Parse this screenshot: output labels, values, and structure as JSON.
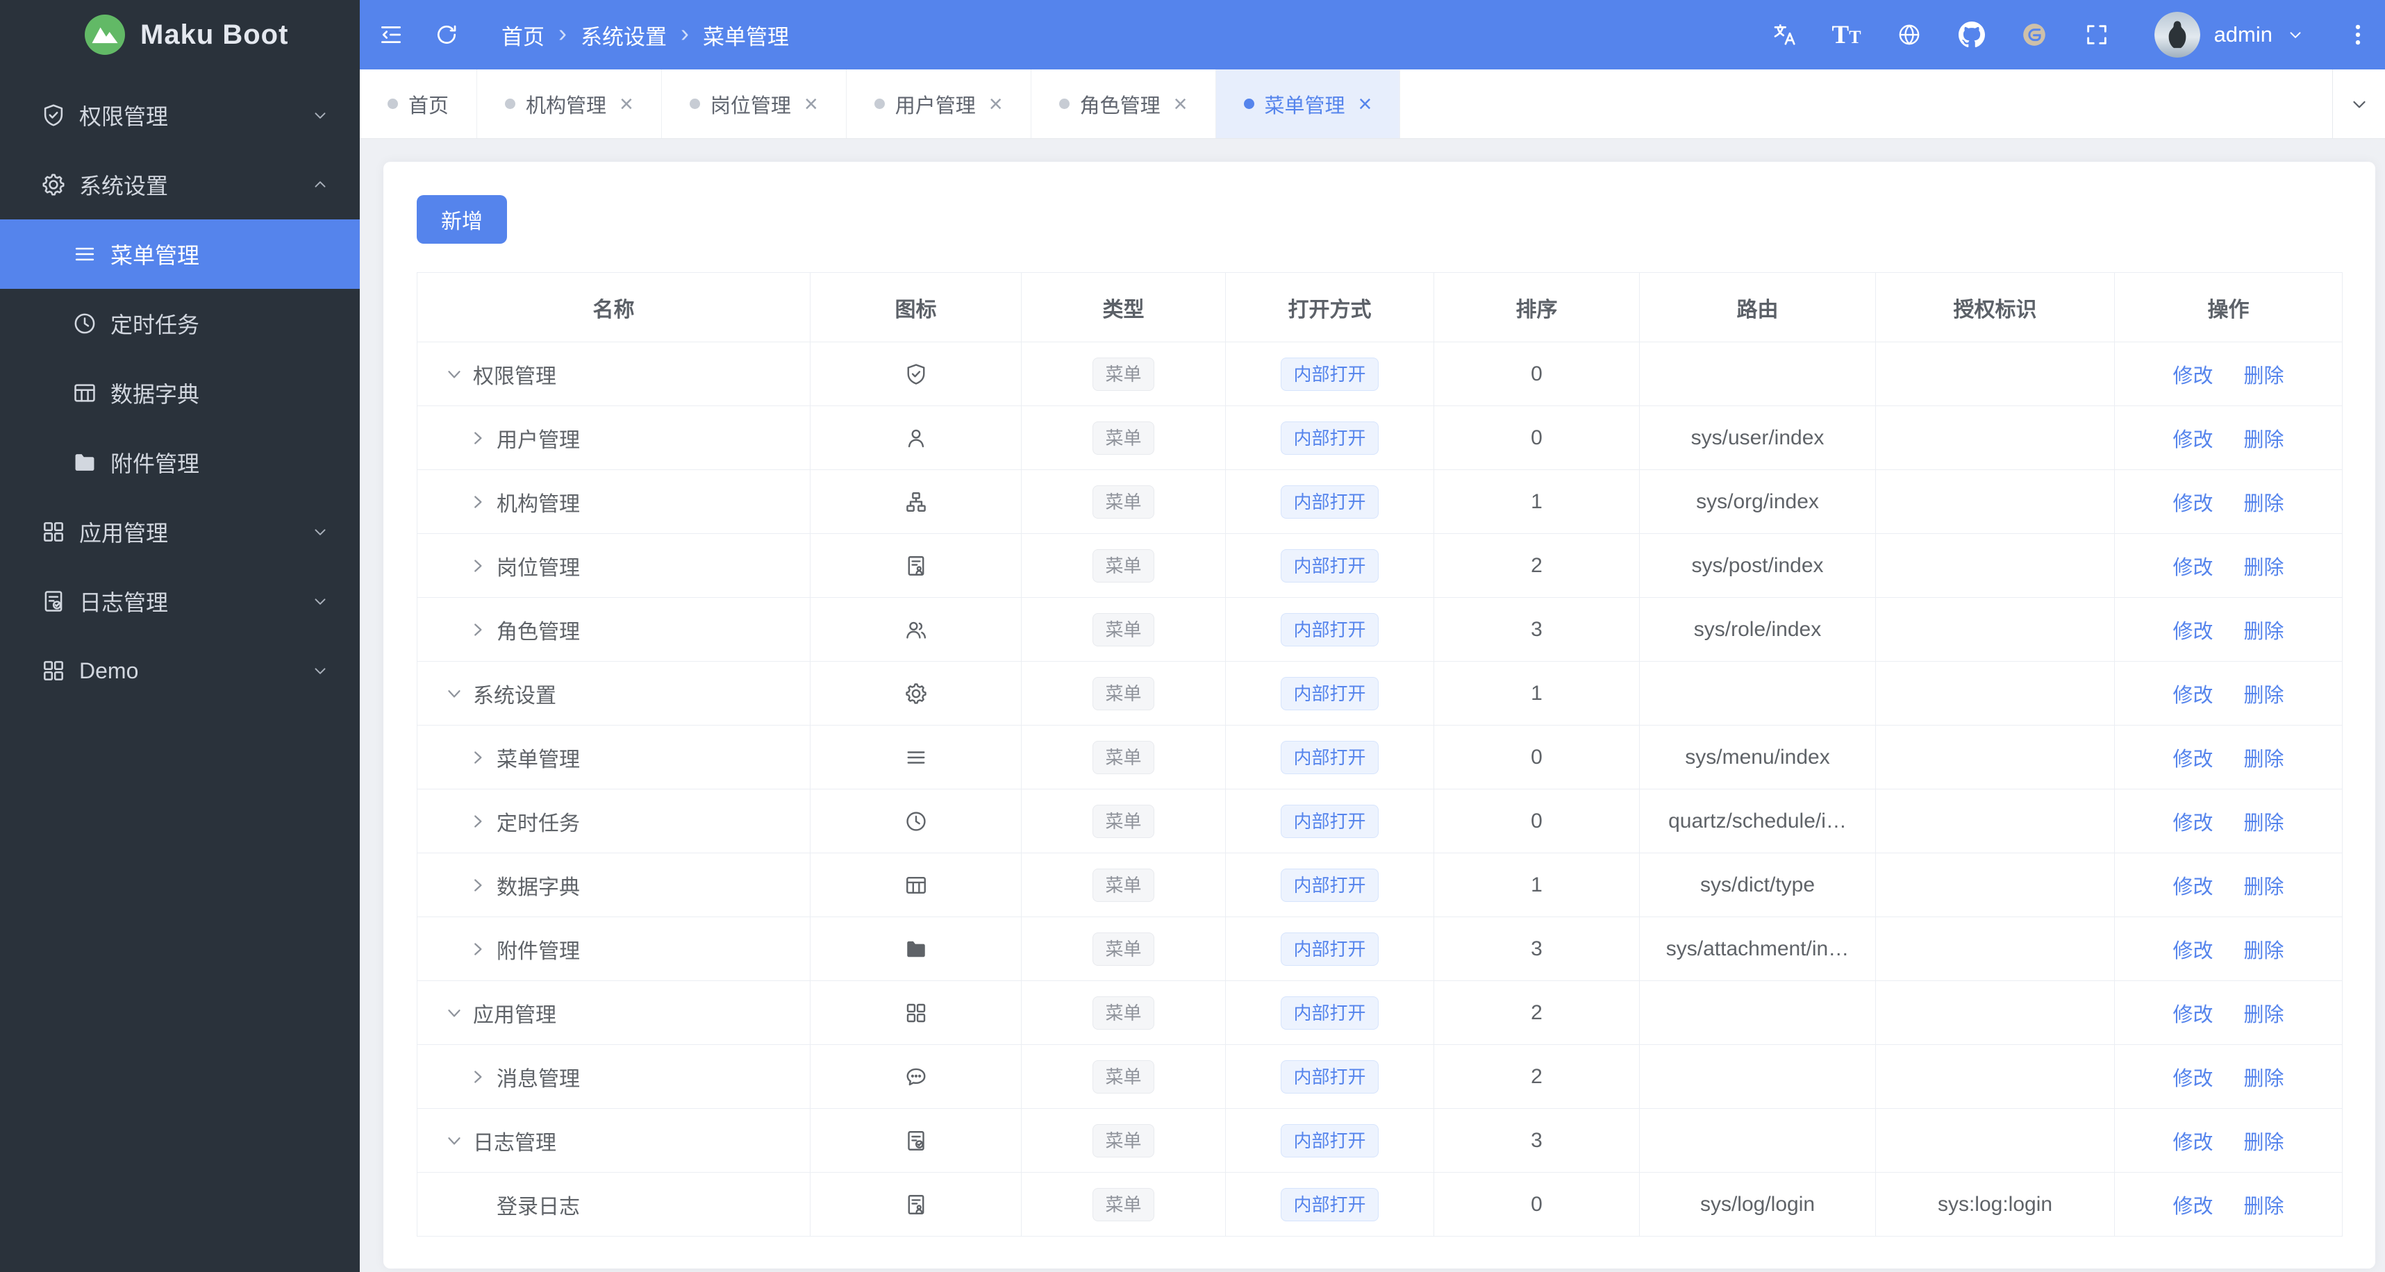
{
  "app": {
    "logo_text": "Maku Boot"
  },
  "colors": {
    "primary": "#5584ec",
    "sidebar_bg": "#2a323b",
    "header_bg": "#5584ec",
    "content_bg": "#eef0f4",
    "tab_active_bg": "#e7eefc",
    "link": "#5584ec",
    "tag_gray_text": "#8f939b",
    "tag_blue_text": "#5584ec",
    "logo_green": "#62b966",
    "gitee_tan": "#cec0a9"
  },
  "sidebar": {
    "items": [
      {
        "label": "权限管理",
        "icon": "shield-check",
        "kind": "group",
        "chevron": "down",
        "active": false
      },
      {
        "label": "系统设置",
        "icon": "gear",
        "kind": "group",
        "chevron": "up",
        "active": false
      },
      {
        "label": "菜单管理",
        "icon": "menu-lines",
        "kind": "sub",
        "chevron": "none",
        "active": true
      },
      {
        "label": "定时任务",
        "icon": "clock",
        "kind": "sub",
        "chevron": "none",
        "active": false
      },
      {
        "label": "数据字典",
        "icon": "grid-table",
        "kind": "sub",
        "chevron": "none",
        "active": false
      },
      {
        "label": "附件管理",
        "icon": "folder",
        "kind": "sub",
        "chevron": "none",
        "active": false
      },
      {
        "label": "应用管理",
        "icon": "app-grid",
        "kind": "group",
        "chevron": "down",
        "active": false
      },
      {
        "label": "日志管理",
        "icon": "doc-check",
        "kind": "group",
        "chevron": "down",
        "active": false
      },
      {
        "label": "Demo",
        "icon": "app-grid",
        "kind": "group",
        "chevron": "down",
        "active": false
      }
    ]
  },
  "header": {
    "breadcrumb": [
      "首页",
      "系统设置",
      "菜单管理"
    ],
    "tools": [
      "translate",
      "font-size",
      "globe",
      "github",
      "gitee",
      "fullscreen"
    ],
    "user": "admin"
  },
  "tabs": {
    "items": [
      {
        "label": "首页",
        "closable": false,
        "active": false
      },
      {
        "label": "机构管理",
        "closable": true,
        "active": false
      },
      {
        "label": "岗位管理",
        "closable": true,
        "active": false
      },
      {
        "label": "用户管理",
        "closable": true,
        "active": false
      },
      {
        "label": "角色管理",
        "closable": true,
        "active": false
      },
      {
        "label": "菜单管理",
        "closable": true,
        "active": true
      }
    ]
  },
  "toolbar": {
    "add_label": "新增"
  },
  "table": {
    "headers": [
      "名称",
      "图标",
      "类型",
      "打开方式",
      "排序",
      "路由",
      "授权标识",
      "操作"
    ],
    "action_labels": {
      "edit": "修改",
      "delete": "删除"
    },
    "rows": [
      {
        "name": "权限管理",
        "icon": "shield-check",
        "level": 0,
        "caret": "down",
        "type": "菜单",
        "open": "内部打开",
        "sort": "0",
        "route": "",
        "perm": ""
      },
      {
        "name": "用户管理",
        "icon": "user",
        "level": 1,
        "caret": "right",
        "type": "菜单",
        "open": "内部打开",
        "sort": "0",
        "route": "sys/user/index",
        "perm": ""
      },
      {
        "name": "机构管理",
        "icon": "org-tree",
        "level": 1,
        "caret": "right",
        "type": "菜单",
        "open": "内部打开",
        "sort": "1",
        "route": "sys/org/index",
        "perm": ""
      },
      {
        "name": "岗位管理",
        "icon": "id-badge",
        "level": 1,
        "caret": "right",
        "type": "菜单",
        "open": "内部打开",
        "sort": "2",
        "route": "sys/post/index",
        "perm": ""
      },
      {
        "name": "角色管理",
        "icon": "users",
        "level": 1,
        "caret": "right",
        "type": "菜单",
        "open": "内部打开",
        "sort": "3",
        "route": "sys/role/index",
        "perm": ""
      },
      {
        "name": "系统设置",
        "icon": "gear",
        "level": 0,
        "caret": "down",
        "type": "菜单",
        "open": "内部打开",
        "sort": "1",
        "route": "",
        "perm": ""
      },
      {
        "name": "菜单管理",
        "icon": "menu-lines",
        "level": 1,
        "caret": "right",
        "type": "菜单",
        "open": "内部打开",
        "sort": "0",
        "route": "sys/menu/index",
        "perm": ""
      },
      {
        "name": "定时任务",
        "icon": "clock",
        "level": 1,
        "caret": "right",
        "type": "菜单",
        "open": "内部打开",
        "sort": "0",
        "route": "quartz/schedule/i…",
        "perm": ""
      },
      {
        "name": "数据字典",
        "icon": "grid-table",
        "level": 1,
        "caret": "right",
        "type": "菜单",
        "open": "内部打开",
        "sort": "1",
        "route": "sys/dict/type",
        "perm": ""
      },
      {
        "name": "附件管理",
        "icon": "folder",
        "level": 1,
        "caret": "right",
        "type": "菜单",
        "open": "内部打开",
        "sort": "3",
        "route": "sys/attachment/in…",
        "perm": ""
      },
      {
        "name": "应用管理",
        "icon": "app-grid",
        "level": 0,
        "caret": "down",
        "type": "菜单",
        "open": "内部打开",
        "sort": "2",
        "route": "",
        "perm": ""
      },
      {
        "name": "消息管理",
        "icon": "chat",
        "level": 1,
        "caret": "right",
        "type": "菜单",
        "open": "内部打开",
        "sort": "2",
        "route": "",
        "perm": ""
      },
      {
        "name": "日志管理",
        "icon": "doc-check",
        "level": 0,
        "caret": "down",
        "type": "菜单",
        "open": "内部打开",
        "sort": "3",
        "route": "",
        "perm": ""
      },
      {
        "name": "登录日志",
        "icon": "id-badge",
        "level": 1,
        "caret": "none",
        "type": "菜单",
        "open": "内部打开",
        "sort": "0",
        "route": "sys/log/login",
        "perm": "sys:log:login"
      }
    ]
  }
}
